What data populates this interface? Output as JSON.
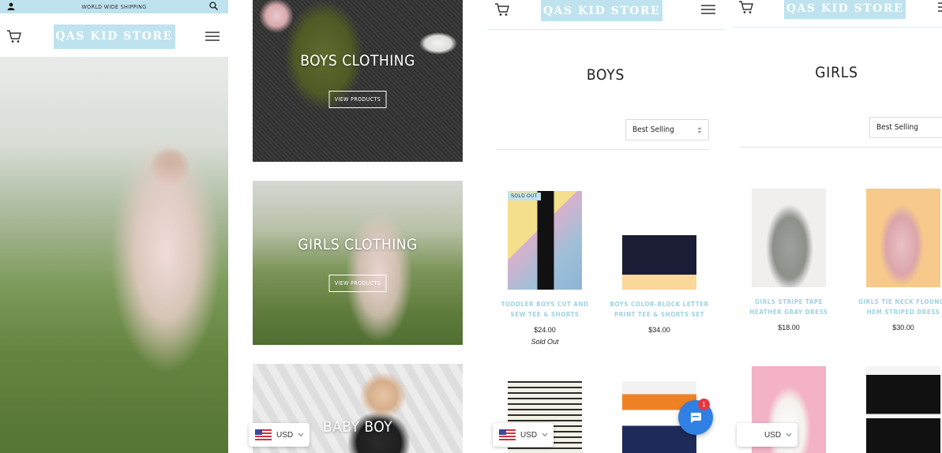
{
  "store": {
    "name": "QAS KID STORE",
    "brand_color": "#bfe3ee",
    "product_name_color": "#9ed3e3"
  },
  "home": {
    "announcement": "WORLD WIDE SHIPPING",
    "icons": [
      "user-icon",
      "search-icon",
      "cart-icon",
      "menu-icon"
    ]
  },
  "collections": [
    {
      "title": "BOYS CLOTHING",
      "button": "VIEW PRODUCTS"
    },
    {
      "title": "GIRLS CLOTHING",
      "button": "VIEW PRODUCTS"
    },
    {
      "title": "BABY BOY"
    }
  ],
  "currency": {
    "label": "USD"
  },
  "boys_page": {
    "title": "BOYS",
    "sort": "Best Selling",
    "products": [
      {
        "name_line1": "TODDLER BOYS CUT AND",
        "name_line2": "SEW TEE & SHORTS",
        "price": "$24.00",
        "status": "Sold Out",
        "badge": "SOLD OUT"
      },
      {
        "name_line1": "BOYS COLOR-BLOCK LETTER",
        "name_line2": "PRINT TEE & SHORTS SET",
        "price": "$34.00"
      }
    ]
  },
  "girls_page": {
    "title": "GIRLS",
    "sort": "Best Selling",
    "products": [
      {
        "name_line1": "GIRLS STRIPE TAPE",
        "name_line2": "HEATHER GRAY DRESS",
        "price": "$18.00"
      },
      {
        "name_line1": "GIRLS TIE NECK FLOUNCE",
        "name_line2": "HEM STRIPED DRESS",
        "price": "$30.00"
      }
    ]
  },
  "chat": {
    "badge_count": "1"
  }
}
